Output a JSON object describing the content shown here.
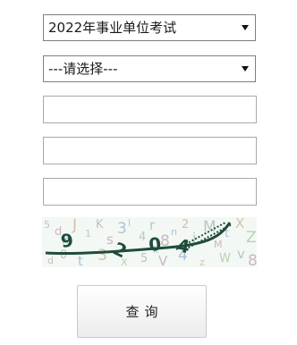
{
  "form": {
    "exam_select": {
      "selected": "2022年事业单位考试"
    },
    "category_select": {
      "selected": "---请选择---"
    },
    "field1": {
      "value": "",
      "placeholder": ""
    },
    "field2": {
      "value": "",
      "placeholder": ""
    },
    "field3": {
      "value": "",
      "placeholder": ""
    },
    "captcha": {
      "glyph_text": "9204",
      "noise_chars": "5dkJ1Ks3l4r8n2iMMtXZd0t3X5V4zWv8k"
    },
    "submit": {
      "label": "查询"
    }
  },
  "colors": {
    "select_border": "#7f7f7f",
    "field_border": "#a9a9a9",
    "captcha_ink": "#1e4d3a",
    "button_border": "#c9c9c9"
  }
}
